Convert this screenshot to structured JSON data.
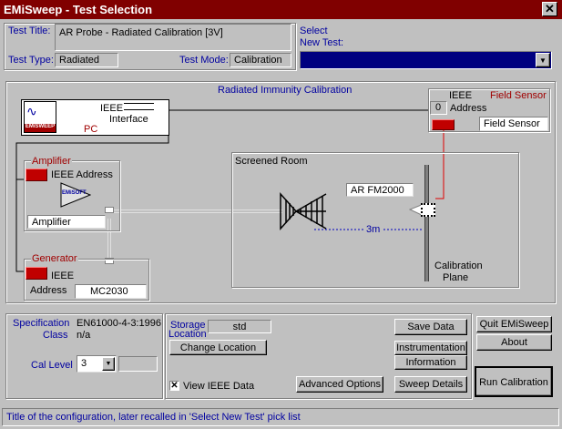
{
  "window": {
    "title": "EMiSweep - Test Selection"
  },
  "header": {
    "test_title_label": "Test Title:",
    "test_title_value": "AR Probe - Radiated Calibration [3V]",
    "test_type_label": "Test Type:",
    "test_type_value": "Radiated",
    "test_mode_label": "Test Mode:",
    "test_mode_value": "Calibration",
    "select_label_1": "Select",
    "select_label_2": "New Test:",
    "select_value": ""
  },
  "diagram": {
    "title": "Radiated Immunity Calibration",
    "pc": {
      "ieee": "IEEE",
      "interface": "Interface",
      "label": "PC",
      "logo": "EMiSWEEP"
    },
    "field_sensor": {
      "ieee": "IEEE",
      "title": "Field Sensor",
      "address": "0",
      "address_label": "Address",
      "name": "Field Sensor"
    },
    "amplifier": {
      "title": "Amplifier",
      "ieee_address": "IEEE Address",
      "name": "Amplifier",
      "logo": "EMiSOFT"
    },
    "generator": {
      "title": "Generator",
      "ieee": "IEEE",
      "address_label": "Address",
      "name": "MC2030"
    },
    "room": {
      "title": "Screened Room",
      "antenna": "AR FM2000",
      "distance": "3m",
      "plane_1": "Calibration",
      "plane_2": "Plane"
    }
  },
  "bottom": {
    "spec_class_label_1": "Specification",
    "spec_class_label_2": "Class",
    "spec_value": "EN61000-4-3:1996",
    "class_value": "n/a",
    "cal_level_label": "Cal Level",
    "cal_level_value": "3",
    "storage_label_1": "Storage",
    "storage_label_2": "Location",
    "storage_value": "std",
    "change_location": "Change Location",
    "view_ieee": "View IEEE Data",
    "advanced_options": "Advanced Options",
    "save_data": "Save Data",
    "instrumentation": "Instrumentation",
    "information": "Information",
    "sweep_details": "Sweep Details",
    "quit": "Quit EMiSweep",
    "about": "About",
    "run_calibration": "Run Calibration"
  },
  "status": "Title of the configuration, later recalled in 'Select New Test' pick list"
}
